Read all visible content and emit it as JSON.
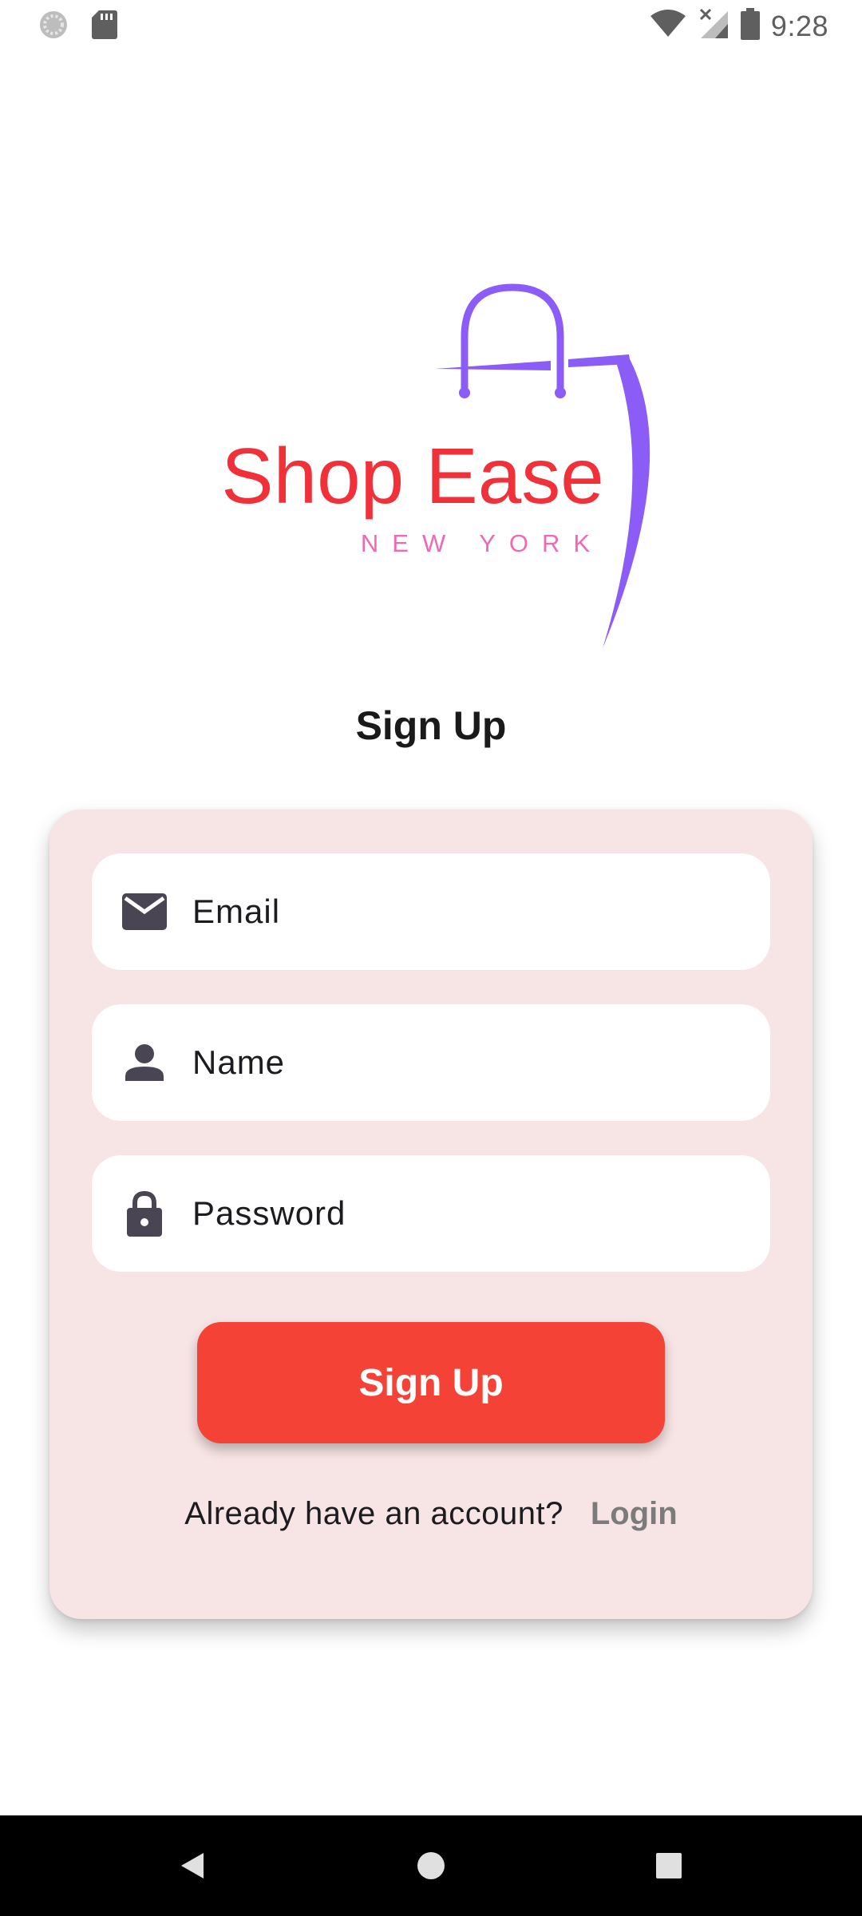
{
  "status_bar": {
    "time": "9:28",
    "left_icons": [
      "sync-icon",
      "sd-card-icon"
    ],
    "right_icons": [
      "wifi-icon",
      "signal-no-service-icon",
      "battery-icon"
    ]
  },
  "logo": {
    "brand": "Shop Ease",
    "location": "NEW YORK",
    "colors": {
      "brand_text": "#f0313a",
      "location_text": "#ee6ab4",
      "bag": "#8b5cf6"
    }
  },
  "page_title": "Sign Up",
  "form": {
    "email": {
      "placeholder": "Email",
      "value": "",
      "icon": "mail-icon"
    },
    "name": {
      "placeholder": "Name",
      "value": "",
      "icon": "person-icon"
    },
    "password": {
      "placeholder": "Password",
      "value": "",
      "icon": "lock-icon"
    },
    "submit_label": "Sign Up"
  },
  "footer": {
    "prompt": "Already have an account?",
    "login_label": "Login"
  },
  "colors": {
    "card_bg": "#f7e4e4",
    "primary_button": "#f44336",
    "link": "#7b7b7b"
  },
  "nav_bar": {
    "buttons": [
      "back-icon",
      "home-icon",
      "recents-icon"
    ]
  }
}
